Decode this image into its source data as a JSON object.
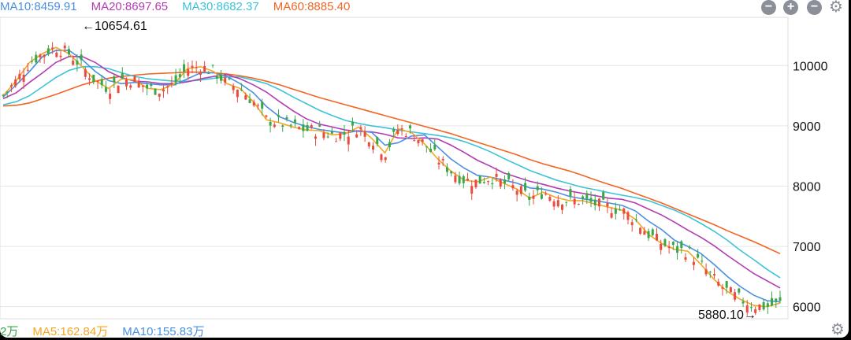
{
  "legend_top": [
    {
      "label": "MA10:8459.91",
      "color": "#4a90e2"
    },
    {
      "label": "MA20:8697.65",
      "color": "#b23cb3"
    },
    {
      "label": "MA30:8682.37",
      "color": "#3dc3d9"
    },
    {
      "label": "MA60:8885.40",
      "color": "#f26522"
    }
  ],
  "legend_bottom": [
    {
      "label": "2万",
      "color": "#3aa64a"
    },
    {
      "label": "MA5:162.84万",
      "color": "#f5a623"
    },
    {
      "label": "MA10:155.83万",
      "color": "#4a90e2"
    }
  ],
  "controls": {
    "zoom_out": "−",
    "zoom_in": "+",
    "collapse": "−"
  },
  "chart_data": {
    "type": "candlestick",
    "y_ticks": [
      "10000",
      "9000",
      "8000",
      "7000",
      "6000"
    ],
    "ylim": [
      5800,
      10800
    ],
    "annotations": [
      {
        "text": "←10654.61",
        "value": 10654.61,
        "kind": "high"
      },
      {
        "text": "5880.10→",
        "value": 5880.1,
        "kind": "low"
      }
    ],
    "colors": {
      "up": "#e74c3c",
      "down": "#3aa64a",
      "grid": "#e6e6e6",
      "axis_text": "#111111"
    },
    "series": [
      {
        "name": "MA5",
        "color": "#f5a623",
        "values": [
          9500,
          9750,
          10050,
          10200,
          10300,
          10200,
          9980,
          9750,
          9620,
          9780,
          9760,
          9620,
          9600,
          9700,
          9950,
          9980,
          9900,
          9700,
          9620,
          9400,
          9100,
          9050,
          8980,
          8930,
          8920,
          8850,
          8870,
          8980,
          8790,
          8550,
          8950,
          8890,
          8700,
          8450,
          8250,
          8100,
          8070,
          8150,
          8050,
          7950,
          7800,
          7900,
          7810,
          7760,
          7760,
          7700,
          7650,
          7600,
          7450,
          7200,
          7050,
          6950,
          6920,
          6700,
          6450,
          6250,
          6120,
          6020,
          6000,
          6060
        ]
      },
      {
        "name": "MA10",
        "color": "#4a90e2",
        "values": [
          9480,
          9680,
          9900,
          10150,
          10250,
          10250,
          10100,
          9900,
          9750,
          9700,
          9720,
          9700,
          9680,
          9680,
          9780,
          9880,
          9880,
          9820,
          9700,
          9550,
          9320,
          9150,
          9060,
          8990,
          8940,
          8910,
          8880,
          8920,
          8890,
          8680,
          8720,
          8830,
          8850,
          8650,
          8450,
          8300,
          8180,
          8150,
          8100,
          8050,
          7970,
          7950,
          7900,
          7830,
          7790,
          7760,
          7720,
          7680,
          7590,
          7420,
          7280,
          7100,
          7000,
          6880,
          6700,
          6500,
          6330,
          6190,
          6100,
          6080
        ]
      },
      {
        "name": "MA20",
        "color": "#b23cb3",
        "values": [
          9450,
          9550,
          9720,
          9880,
          10050,
          10150,
          10150,
          10050,
          9900,
          9800,
          9740,
          9730,
          9700,
          9700,
          9730,
          9780,
          9820,
          9850,
          9780,
          9680,
          9560,
          9400,
          9250,
          9120,
          9030,
          8980,
          8930,
          8910,
          8900,
          8860,
          8800,
          8790,
          8800,
          8780,
          8680,
          8560,
          8430,
          8330,
          8220,
          8150,
          8080,
          8030,
          7970,
          7920,
          7880,
          7840,
          7800,
          7780,
          7720,
          7620,
          7520,
          7400,
          7270,
          7150,
          7010,
          6850,
          6700,
          6550,
          6430,
          6310
        ]
      },
      {
        "name": "MA30",
        "color": "#3dc3d9",
        "values": [
          9350,
          9400,
          9500,
          9650,
          9800,
          9920,
          9980,
          9980,
          9950,
          9880,
          9820,
          9780,
          9760,
          9740,
          9740,
          9760,
          9790,
          9810,
          9810,
          9760,
          9700,
          9600,
          9480,
          9370,
          9260,
          9170,
          9090,
          9040,
          9000,
          8970,
          8930,
          8900,
          8870,
          8840,
          8800,
          8740,
          8660,
          8570,
          8460,
          8360,
          8260,
          8180,
          8100,
          8040,
          7980,
          7940,
          7890,
          7850,
          7810,
          7760,
          7680,
          7600,
          7500,
          7380,
          7250,
          7100,
          6930,
          6780,
          6620,
          6480
        ]
      },
      {
        "name": "MA60",
        "color": "#f26522",
        "values": [
          9330,
          9340,
          9380,
          9450,
          9520,
          9600,
          9680,
          9740,
          9790,
          9820,
          9840,
          9860,
          9870,
          9880,
          9890,
          9890,
          9880,
          9860,
          9830,
          9790,
          9740,
          9680,
          9610,
          9540,
          9470,
          9410,
          9350,
          9290,
          9230,
          9170,
          9110,
          9050,
          8990,
          8930,
          8870,
          8800,
          8730,
          8660,
          8590,
          8520,
          8440,
          8370,
          8310,
          8250,
          8180,
          8100,
          8030,
          7960,
          7880,
          7800,
          7720,
          7630,
          7540,
          7450,
          7360,
          7260,
          7170,
          7080,
          6980,
          6880
        ]
      }
    ]
  }
}
